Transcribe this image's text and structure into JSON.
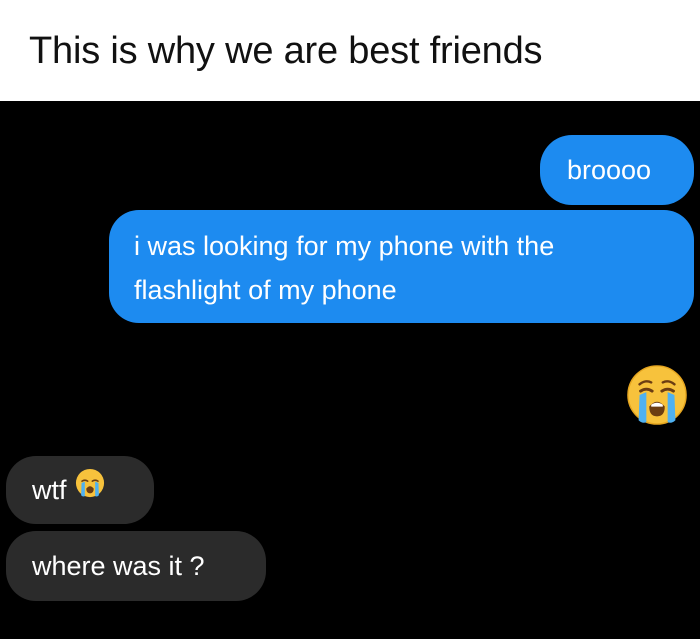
{
  "caption": {
    "text": "This is why we are best friends"
  },
  "conversation": {
    "messages": [
      {
        "direction": "sent",
        "text": "broooo"
      },
      {
        "direction": "sent",
        "lines": [
          "i was looking for my phone with the",
          "flashlight of my phone"
        ]
      },
      {
        "direction": "sent",
        "emoji": "loudly-crying-face"
      },
      {
        "direction": "received",
        "text": "wtf",
        "emoji": "loudly-crying-face"
      },
      {
        "direction": "received",
        "text": "where was it ?"
      }
    ]
  },
  "colors": {
    "chat_background": "#000000",
    "sent_bubble": "#1d8bf0",
    "received_bubble": "#2b2b2b",
    "caption_background": "#ffffff",
    "caption_text": "#111111"
  }
}
